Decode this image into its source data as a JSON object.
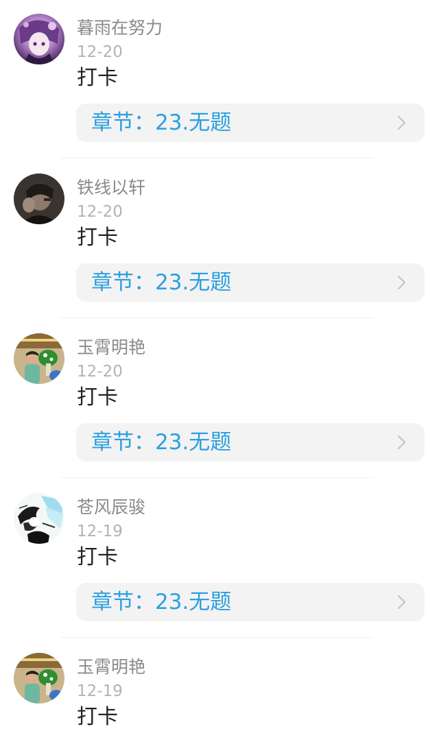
{
  "posts": [
    {
      "username": "暮雨在努力",
      "date": "12-20",
      "content": "打卡",
      "chapter_label": "章节：23.无题",
      "avatar_icon": "anime-girl-avatar"
    },
    {
      "username": "铁线以轩",
      "date": "12-20",
      "content": "打卡",
      "chapter_label": "章节：23.无题",
      "avatar_icon": "person-photo-avatar"
    },
    {
      "username": "玉霄明艳",
      "date": "12-20",
      "content": "打卡",
      "chapter_label": "章节：23.无题",
      "avatar_icon": "child-photo-avatar"
    },
    {
      "username": "苍风辰骏",
      "date": "12-19",
      "content": "打卡",
      "chapter_label": "章节：23.无题",
      "avatar_icon": "anime-sketch-avatar"
    },
    {
      "username": "玉霄明艳",
      "date": "12-19",
      "content": "打卡",
      "avatar_icon": "child-photo-avatar"
    }
  ],
  "colors": {
    "username": "#8a8a8a",
    "date": "#b3b3b3",
    "content": "#222222",
    "chapter_link": "#2b9fe0",
    "card_background": "#f3f3f3"
  }
}
